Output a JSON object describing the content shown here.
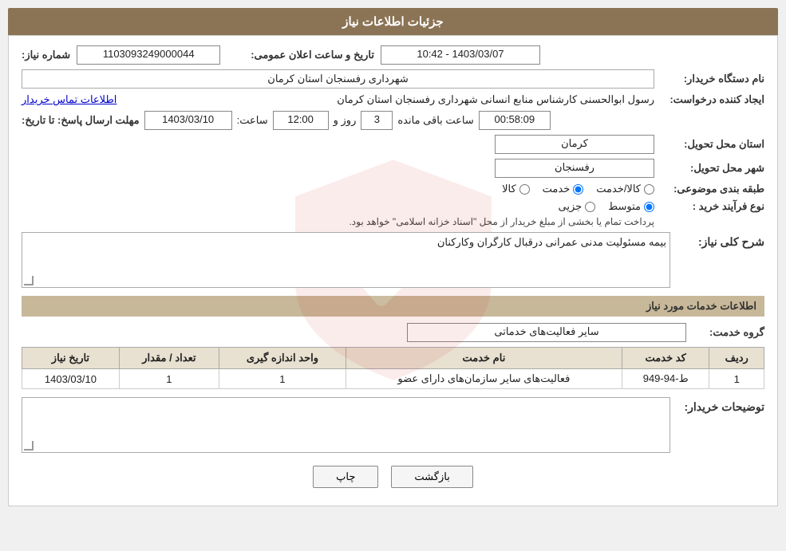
{
  "header": {
    "title": "جزئیات اطلاعات نیاز"
  },
  "fields": {
    "shomare_niyaz_label": "شماره نیاز:",
    "shomare_niyaz_value": "1103093249000044",
    "tarikh_label": "تاریخ و ساعت اعلان عمومی:",
    "tarikh_value": "1403/03/07 - 10:42",
    "nam_dastgah_label": "نام دستگاه خریدار:",
    "nam_dastgah_value": "شهرداری رفسنجان استان کرمان",
    "ijad_konande_label": "ایجاد کننده درخواست:",
    "ijad_konande_value": "رسول ابوالحسنی کارشناس منابع انسانی شهرداری رفسنجان استان کرمان",
    "ettelaat_tamas_label": "اطلاعات تماس خریدار",
    "mohlat_label": "مهلت ارسال پاسخ: تا تاریخ:",
    "mohlat_tarikh": "1403/03/10",
    "mohlat_saat_label": "ساعت:",
    "mohlat_saat_value": "12:00",
    "mohlat_roz_label": "روز و",
    "mohlat_roz_value": "3",
    "saat_baqi_label": "ساعت باقی مانده",
    "saat_baqi_value": "00:58:09",
    "ostan_label": "استان محل تحویل:",
    "ostan_value": "کرمان",
    "shahr_label": "شهر محل تحویل:",
    "shahr_value": "رفسنجان",
    "tabaqe_label": "طبقه بندی موضوعی:",
    "tabaqe_options": [
      {
        "id": "kala",
        "label": "کالا"
      },
      {
        "id": "khadamat",
        "label": "خدمت"
      },
      {
        "id": "kala_khadamat",
        "label": "کالا/خدمت"
      }
    ],
    "tabaqe_selected": "khadamat",
    "noeFarayand_label": "نوع فرآیند خرید :",
    "noeFarayand_options": [
      {
        "id": "jozii",
        "label": "جزیی"
      },
      {
        "id": "motevasset",
        "label": "متوسط"
      }
    ],
    "noeFarayand_selected": "motevasset",
    "noeFarayand_note": "پرداخت تمام یا بخشی از مبلغ خریدار از محل \"اسناد خزانه اسلامی\" خواهد بود.",
    "sharh_label": "شرح کلی نیاز:",
    "sharh_value": "بیمه مسئولیت مدنی عمرانی درقبال کارگران وکارکنان",
    "khadamat_title": "اطلاعات خدمات مورد نیاز",
    "gorohe_label": "گروه خدمت:",
    "gorohe_value": "سایر فعالیت‌های خدماتی",
    "table": {
      "headers": [
        "ردیف",
        "کد خدمت",
        "نام خدمت",
        "واحد اندازه گیری",
        "تعداد / مقدار",
        "تاریخ نیاز"
      ],
      "rows": [
        {
          "radif": "1",
          "kod": "ط-94-949",
          "nam": "فعالیت‌های سایر سازمان‌های دارای عضو",
          "vahed": "1",
          "tedad": "1",
          "tarikh": "1403/03/10"
        }
      ]
    },
    "tozihat_label": "توضیحات خریدار:",
    "tozihat_value": ""
  },
  "buttons": {
    "print_label": "چاپ",
    "back_label": "بازگشت"
  }
}
